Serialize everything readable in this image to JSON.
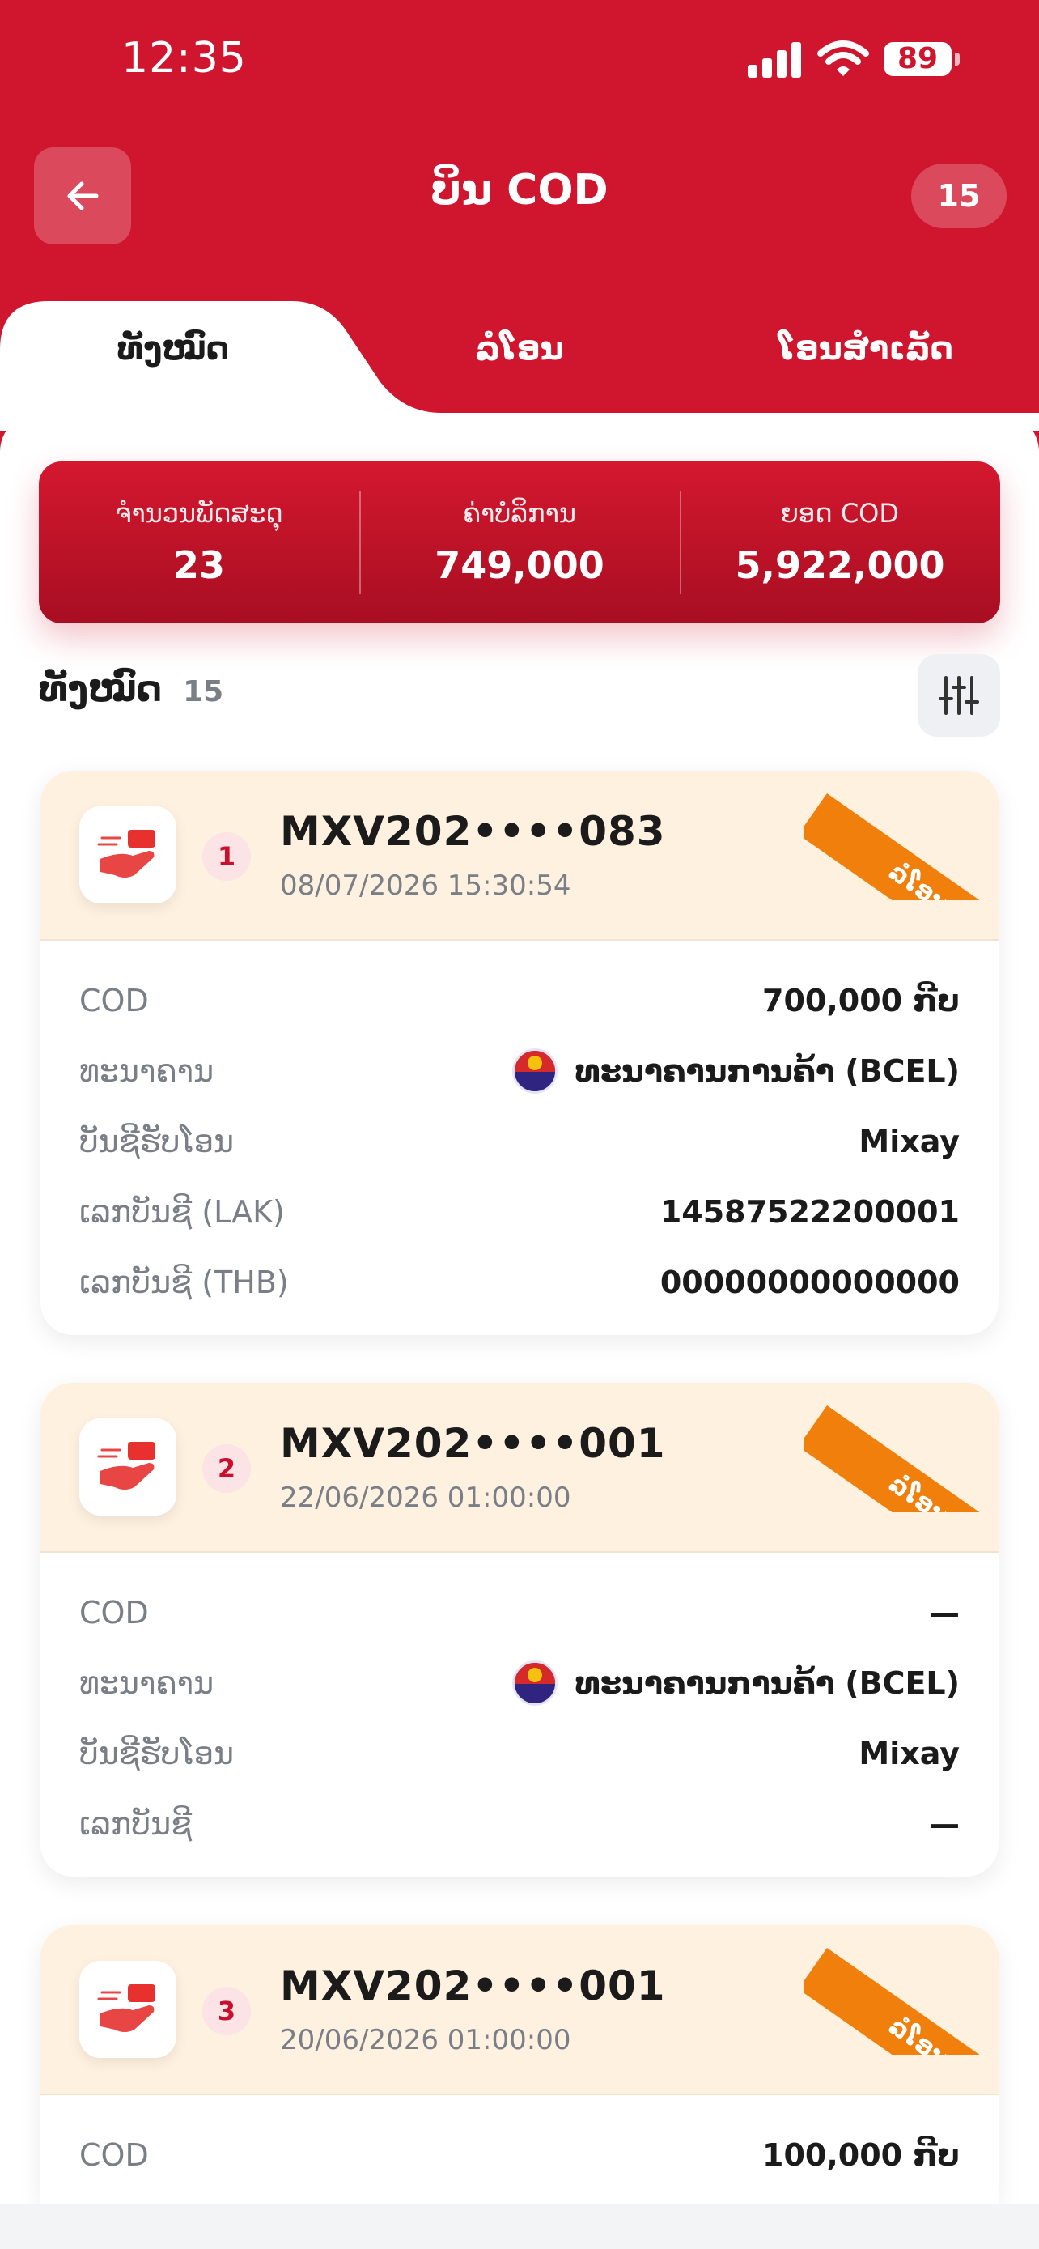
{
  "status_bar": {
    "time": "12:35",
    "battery": "89"
  },
  "header": {
    "title": "ບິນ COD",
    "count": "15"
  },
  "tabs": [
    {
      "label": "ທັງໝົດ",
      "active": true
    },
    {
      "label": "ລໍໂອນ",
      "active": false
    },
    {
      "label": "ໂອນສຳເລັດ",
      "active": false
    }
  ],
  "summary": [
    {
      "label": "ຈຳນວນພັດສະດຸ",
      "value": "23"
    },
    {
      "label": "ຄ່າບໍລິການ",
      "value": "749,000"
    },
    {
      "label": "ຍອດ COD",
      "value": "5,922,000"
    }
  ],
  "section": {
    "title": "ທັງໝົດ",
    "count": "15"
  },
  "cards": [
    {
      "index": "1",
      "tracking": "MXV202••••083",
      "datetime": "08/07/2026 15:30:54",
      "status": "ລໍໂອນ",
      "rows": [
        {
          "label": "COD",
          "value": "700,000 ກີບ"
        },
        {
          "label": "ທະນາຄານ",
          "value": "ທະນາຄານການຄ້າ (BCEL)"
        },
        {
          "label": "ບັນຊີຮັບໂອນ",
          "value": "Mixay"
        },
        {
          "label": "ເລກບັນຊີ (LAK)",
          "value": "14587522200001"
        },
        {
          "label": "ເລກບັນຊີ (THB)",
          "value": "00000000000000"
        }
      ]
    },
    {
      "index": "2",
      "tracking": "MXV202••••001",
      "datetime": "22/06/2026 01:00:00",
      "status": "ລໍໂອນ",
      "rows": [
        {
          "label": "COD",
          "value": "—"
        },
        {
          "label": "ທະນາຄານ",
          "value": "ທະນາຄານການຄ້າ (BCEL)"
        },
        {
          "label": "ບັນຊີຮັບໂອນ",
          "value": "Mixay"
        },
        {
          "label": "ເລກບັນຊີ",
          "value": "—"
        }
      ]
    },
    {
      "index": "3",
      "tracking": "MXV202••••001",
      "datetime": "20/06/2026 01:00:00",
      "status": "ລໍໂອນ",
      "rows": [
        {
          "label": "COD",
          "value": "100,000 ກີບ"
        }
      ]
    }
  ],
  "icons": {
    "back": "arrow-left-icon",
    "filter": "sliders-icon",
    "cod": "cod-hand-icon",
    "bank": "bcel-logo"
  },
  "colors": {
    "brand_red": "#d0162f",
    "ribbon_orange": "#f07f0c",
    "card_header": "#fef1df"
  }
}
